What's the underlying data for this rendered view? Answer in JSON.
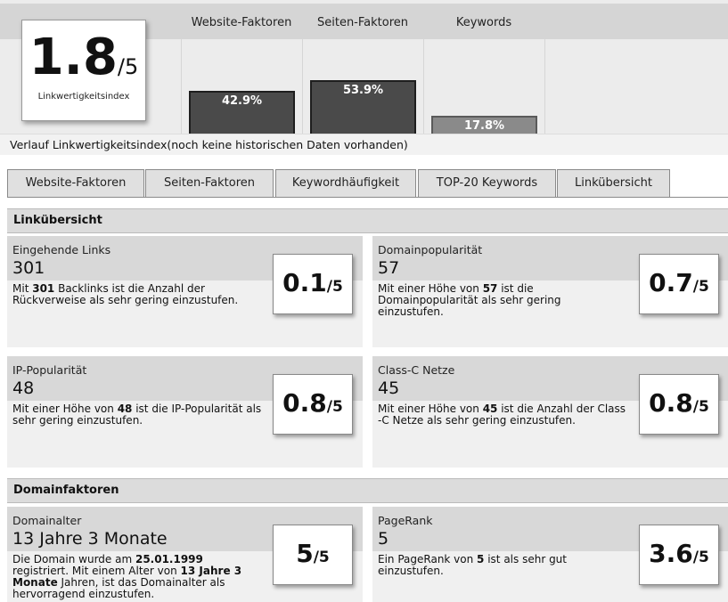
{
  "header": {
    "score_value": "1.8",
    "score_den": "/5",
    "score_caption": "Linkwertigkeitsindex",
    "columns": [
      {
        "label": "Website-Faktoren",
        "percent": "42.9%",
        "fill": 0.429
      },
      {
        "label": "Seiten-Faktoren",
        "percent": "53.9%",
        "fill": 0.539
      },
      {
        "label": "Keywords",
        "percent": "17.8%",
        "fill": 0.178
      }
    ]
  },
  "verlauf": "Verlauf Linkwertigkeitsindex(noch keine historischen Daten vorhanden)",
  "tabs": [
    {
      "label": "Website-Faktoren"
    },
    {
      "label": "Seiten-Faktoren"
    },
    {
      "label": "Keywordhäufigkeit"
    },
    {
      "label": "TOP-20 Keywords"
    },
    {
      "label": "Linkübersicht"
    }
  ],
  "sections": {
    "links_title": "Linkübersicht",
    "domain_title": "Domainfaktoren"
  },
  "cards": {
    "eingehende": {
      "title": "Eingehende Links",
      "value": "301",
      "desc_a": "Mit ",
      "desc_b": "301",
      "desc_c": " Backlinks ist die Anzahl der Rückverweise als sehr gering einzustufen.",
      "rating": "0.1",
      "den": "/5"
    },
    "domainpop": {
      "title": "Domainpopularität",
      "value": "57",
      "desc_a": "Mit einer Höhe von ",
      "desc_b": "57",
      "desc_c": " ist die Domainpopularität als sehr gering einzustufen.",
      "rating": "0.7",
      "den": "/5"
    },
    "ippop": {
      "title": "IP-Popularität",
      "value": "48",
      "desc_a": "Mit einer Höhe von ",
      "desc_b": "48",
      "desc_c": " ist die IP-Popularität als sehr gering einzustufen.",
      "rating": "0.8",
      "den": "/5"
    },
    "classc": {
      "title": "Class-C Netze",
      "value": "45",
      "desc_a": "Mit einer Höhe von ",
      "desc_b": "45",
      "desc_c": " ist die Anzahl der Class -C Netze als sehr gering einzustufen.",
      "rating": "0.8",
      "den": "/5"
    },
    "domainalter": {
      "title": "Domainalter",
      "value": "13 Jahre 3 Monate",
      "desc_a": "Die Domain wurde am ",
      "desc_b": "25.01.1999",
      "desc_c": " registriert. Mit einem Alter von ",
      "desc_d": "13 Jahre 3 Monate",
      "desc_e": " Jahren, ist das Domainalter als hervorragend einzustufen.",
      "rating": "5",
      "den": "/5"
    },
    "pagerank": {
      "title": "PageRank",
      "value": "5",
      "desc_a": "Ein PageRank von ",
      "desc_b": "5",
      "desc_c": " ist als sehr gut einzustufen.",
      "rating": "3.6",
      "den": "/5"
    }
  }
}
